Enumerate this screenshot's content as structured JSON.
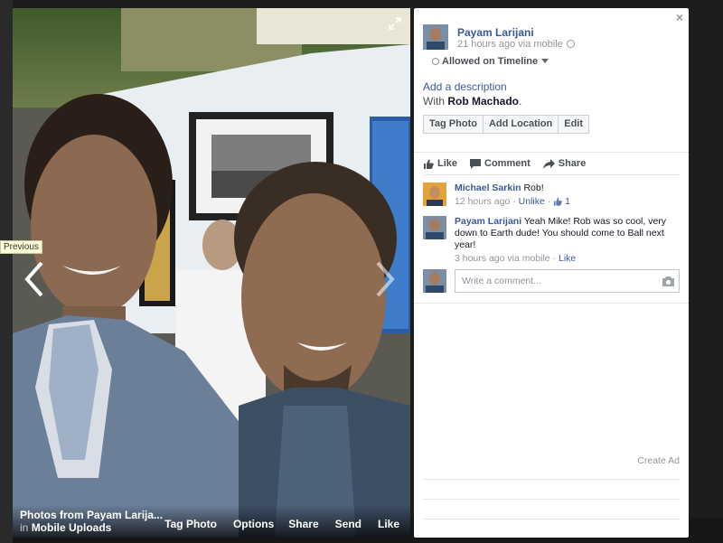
{
  "photo_footer": {
    "album_title": "Photos from Payam Larija...",
    "album_in": "in",
    "album_name": "Mobile Uploads",
    "actions": [
      "Tag Photo",
      "Options",
      "Share",
      "Send",
      "Like"
    ]
  },
  "viewer": {
    "prev_tooltip": "Previous"
  },
  "post": {
    "owner_name": "Payam Larijani",
    "owner_meta": "21 hours ago via mobile",
    "audience": "Allowed on Timeline",
    "add_description": "Add a description",
    "with_prefix": "With",
    "with_name": "Rob Machado",
    "with_suffix": ".",
    "buttons": [
      "Tag Photo",
      "Add Location",
      "Edit"
    ]
  },
  "ufi": {
    "like": "Like",
    "comment": "Comment",
    "share": "Share"
  },
  "comments": [
    {
      "author": "Michael Sarkin",
      "text": "Rob!",
      "time": "12 hours ago",
      "action": "Unlike",
      "likes": "1"
    },
    {
      "author": "Payam Larijani",
      "text": "Yeah Mike! Rob was so cool, very down to Earth dude! You should come to Ball next year!",
      "time": "3 hours ago via mobile",
      "action": "Like"
    }
  ],
  "reply": {
    "placeholder": "Write a comment..."
  },
  "sidebar": {
    "create_ad": "Create Ad"
  },
  "colors": {
    "link": "#3b5998",
    "muted": "#90949c"
  }
}
